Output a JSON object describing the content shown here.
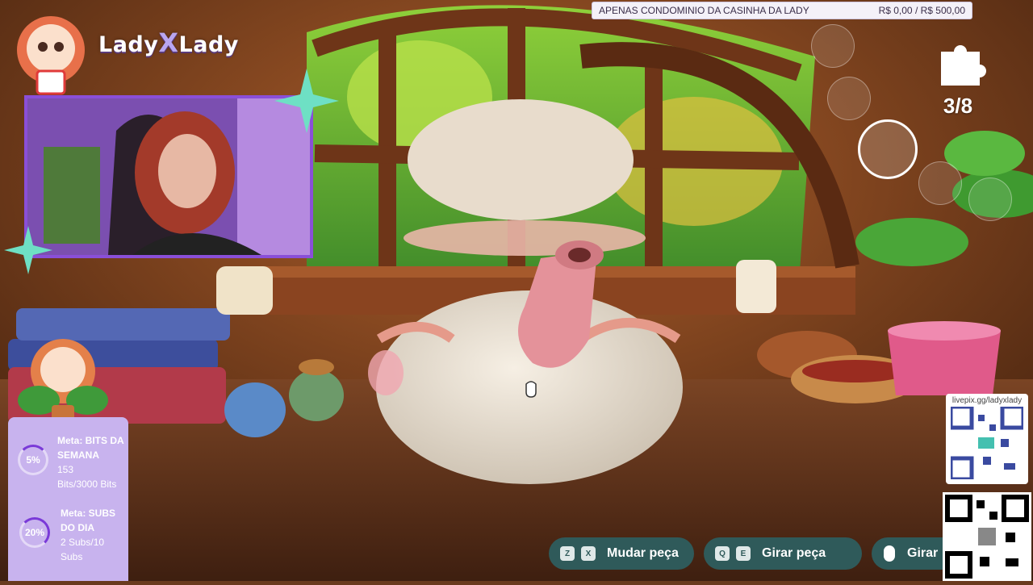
{
  "goal_bar": {
    "title": "APENAS CONDOMINIO DA CASINHA DA LADY",
    "amount": "R$ 0,00 / R$ 500,00"
  },
  "logo": {
    "left": "Lady",
    "mid": "X",
    "right": "Lady"
  },
  "puzzle": {
    "counter": "3/8",
    "icon": "puzzle-piece-icon"
  },
  "meta_panel": {
    "bits": {
      "percent": "5%",
      "label_line1": "Meta: BITS DA",
      "label_line2": "SEMANA",
      "value_line1": "153",
      "value_line2": "Bits/3000 Bits",
      "progress": 0.05
    },
    "subs": {
      "percent": "20%",
      "label_line1": "Meta: SUBS",
      "label_line2": "DO DIA",
      "value_line1": "2 Subs/10",
      "value_line2": "Subs",
      "progress": 0.2
    }
  },
  "controls": [
    {
      "keys": [
        "Z",
        "X"
      ],
      "label": "Mudar peça"
    },
    {
      "keys": [
        "Q",
        "E"
      ],
      "label": "Girar peça"
    },
    {
      "keys": [],
      "label": "Girar"
    }
  ],
  "qr": {
    "url_label": "livepix.gg/ladyxlady"
  },
  "colors": {
    "accent": "#8a4fd8",
    "control_bg": "#2f5a5a",
    "panel": "#c8b3ee"
  }
}
